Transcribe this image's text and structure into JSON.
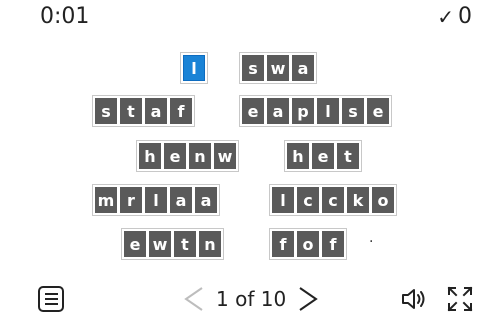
{
  "header": {
    "timer": "0:01",
    "score_icon": "check-icon",
    "score": "0"
  },
  "colors": {
    "tile": "#5a5a5a",
    "tile_text": "#ffffff",
    "selected_tile": "#1a83d6"
  },
  "puzzle": {
    "rows": [
      {
        "words": [
          {
            "letters": [
              "l"
            ],
            "selected_index": 0
          },
          {
            "letters": [
              "s",
              "w",
              "a"
            ]
          }
        ]
      },
      {
        "words": [
          {
            "letters": [
              "s",
              "t",
              "a",
              "f"
            ]
          },
          {
            "letters": [
              "e",
              "a",
              "p",
              "l",
              "s",
              "e"
            ]
          }
        ]
      },
      {
        "words": [
          {
            "letters": [
              "h",
              "e",
              "n",
              "w"
            ]
          },
          {
            "letters": [
              "h",
              "e",
              "t"
            ]
          }
        ]
      },
      {
        "words": [
          {
            "letters": [
              "m",
              "r",
              "l",
              "a",
              "a"
            ]
          },
          {
            "letters": [
              "l",
              "c",
              "c",
              "k",
              "o"
            ]
          }
        ]
      },
      {
        "words": [
          {
            "letters": [
              "e",
              "w",
              "t",
              "n"
            ]
          },
          {
            "letters": [
              "f",
              "o",
              "f"
            ]
          }
        ],
        "trailing": "·"
      }
    ]
  },
  "toolbar": {
    "menu_icon": "menu-icon",
    "prev_icon": "chevron-left-icon",
    "page_label": "1 of 10",
    "next_icon": "chevron-right-icon",
    "sound_icon": "speaker-icon",
    "fullscreen_icon": "fullscreen-icon"
  }
}
